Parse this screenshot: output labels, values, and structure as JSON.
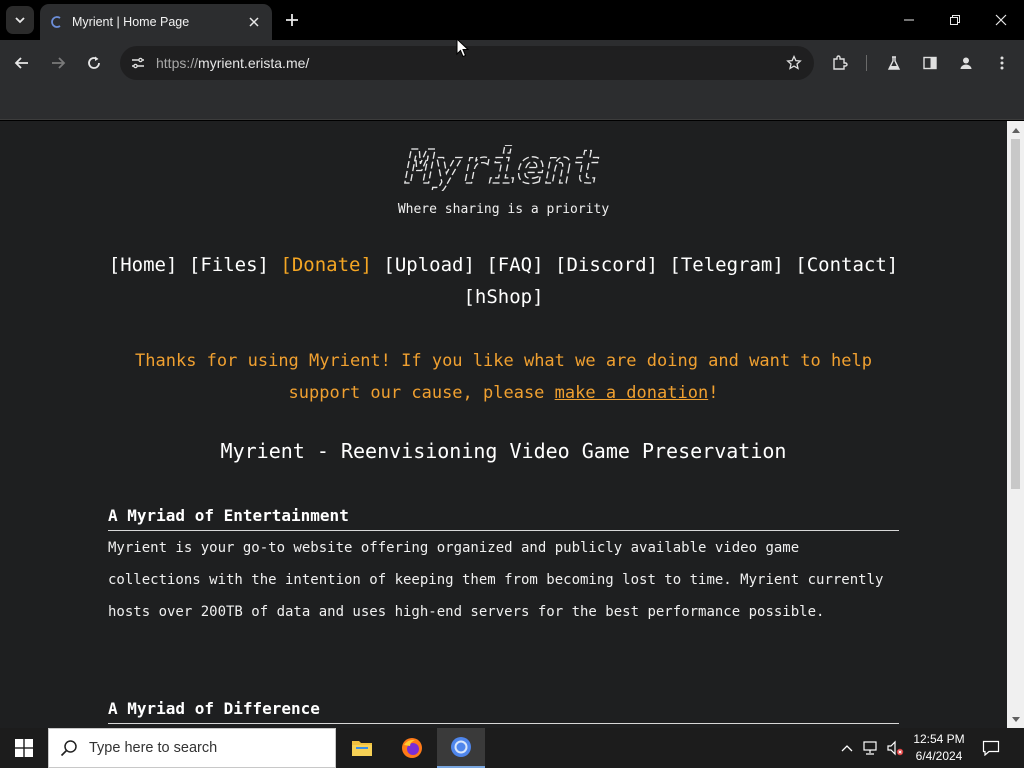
{
  "browser": {
    "tab_title": "Myrient | Home Page",
    "url_scheme": "https://",
    "url_host": "myrient.erista.me/"
  },
  "page": {
    "logo_text": "Myrient",
    "tagline": "Where sharing is a priority",
    "nav": {
      "home": "[Home]",
      "files": "[Files]",
      "donate": "[Donate]",
      "upload": "[Upload]",
      "faq": "[FAQ]",
      "discord": "[Discord]",
      "telegram": "[Telegram]",
      "contact": "[Contact]",
      "hshop": "[hShop]"
    },
    "thanks_before": "Thanks for using Myrient! If you like what we are doing and want to help support our cause, please ",
    "thanks_link": "make a donation",
    "thanks_after": "!",
    "headline": "Myrient - Reenvisioning Video Game Preservation",
    "sections": [
      {
        "heading": "A Myriad of Entertainment",
        "body": "Myrient is your go-to website offering organized and publicly available video game collections with the intention of keeping them from becoming lost to time. Myrient currently hosts over 200TB of data and uses high-end servers for the best performance possible."
      },
      {
        "heading": "A Myriad of Difference",
        "body": ""
      }
    ],
    "accent_color": "#f0a030",
    "background_color": "#1e1f20"
  },
  "taskbar": {
    "search_placeholder": "Type here to search",
    "time": "12:54 PM",
    "date": "6/4/2024"
  },
  "icons": [
    "tab-search-icon",
    "chrome-favicon-icon",
    "close-icon",
    "plus-icon",
    "minimize-icon",
    "restore-icon",
    "back-icon",
    "forward-icon",
    "reload-icon",
    "site-info-icon",
    "star-icon",
    "extensions-icon",
    "labs-icon",
    "side-panel-icon",
    "profile-icon",
    "menu-icon",
    "windows-start-icon",
    "search-icon",
    "file-explorer-icon",
    "firefox-icon",
    "chrome-icon",
    "chevron-up-icon",
    "network-icon",
    "volume-muted-icon",
    "notifications-icon"
  ]
}
